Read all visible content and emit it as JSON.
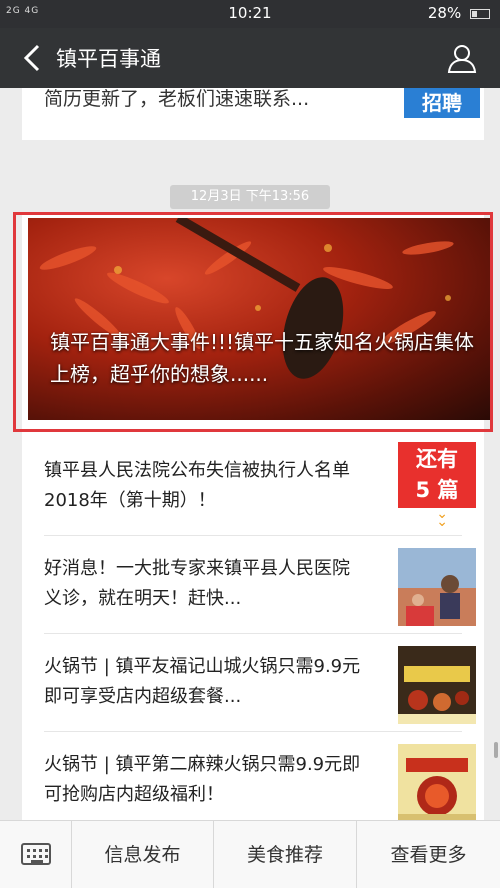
{
  "status_bar": {
    "signal_text": "2G 4G",
    "time": "10:21",
    "battery": "28%"
  },
  "nav": {
    "title": "镇平百事通"
  },
  "top_card": {
    "truncated_text": "简历更新了，老板们速速联系...",
    "thumb_text": "招聘"
  },
  "timestamp": "12月3日 下午13:56",
  "hero": {
    "caption": "镇平百事通大事件!!!镇平十五家知名火锅店集体上榜，超乎你的想象......"
  },
  "more_badge": {
    "line1": "还有",
    "line2": "5 篇"
  },
  "list": [
    {
      "title": "镇平县人民法院公布失信被执行人名单2018年（第十期）！"
    },
    {
      "title": "好消息！一大批专家来镇平县人民医院义诊，就在明天！赶快..."
    },
    {
      "title": "火锅节 | 镇平友福记山城火锅只需9.9元即可享受店内超级套餐..."
    },
    {
      "title": "火锅节 | 镇平第二麻辣火锅只需9.9元即可抢购店内超级福利！"
    }
  ],
  "bottom_menu": {
    "item1": "信息发布",
    "item2": "美食推荐",
    "item3": "查看更多"
  },
  "colors": {
    "nav_bg": "#323436",
    "highlight_border": "#e0383c",
    "badge_red": "#e8302d"
  }
}
